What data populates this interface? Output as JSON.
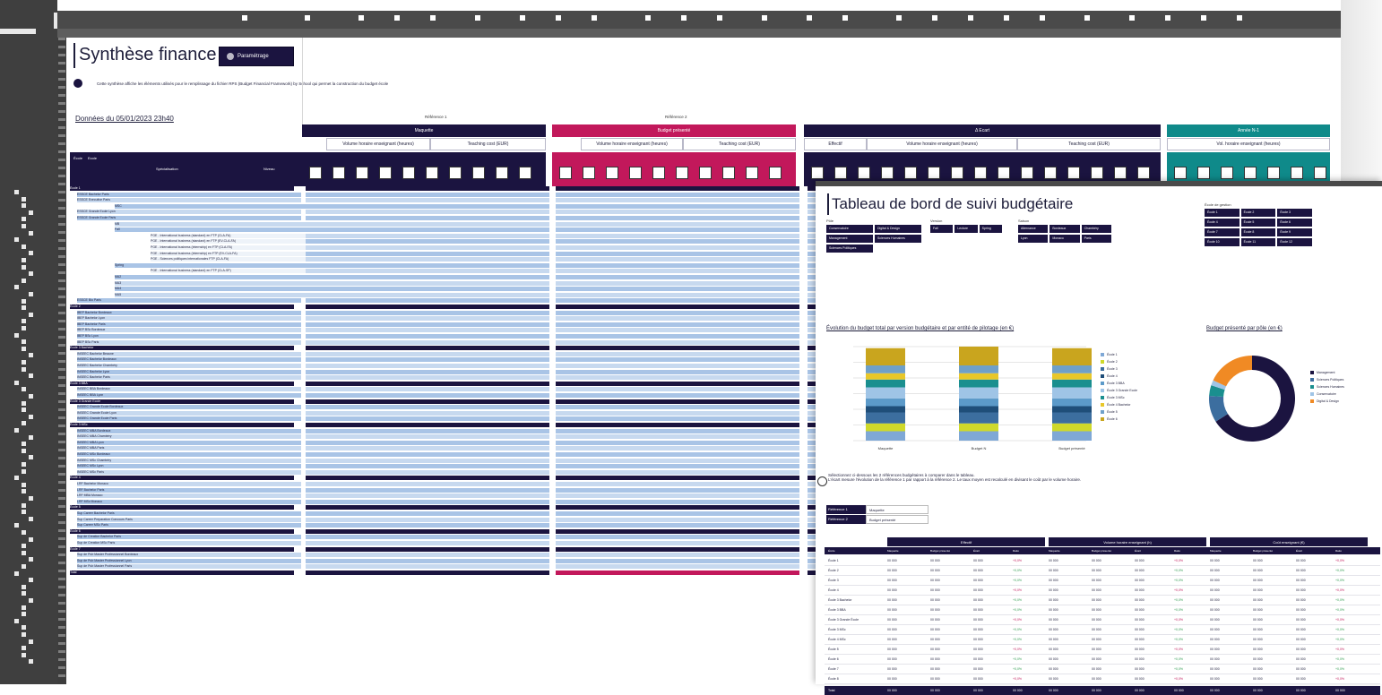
{
  "sheet": {
    "title": "Synthèse finance",
    "param_button": "Paramétrage",
    "info_text": "Cette synthèse affiche les éléments utilisés pour le remplissage du fichier RPS (Budget Financial Framework) by School qui permet la construction du budget école",
    "data_date": "Données du 05/01/2023 23h40",
    "ref1_label": "Référence 1",
    "ref2_label": "Référence 2",
    "groups": [
      "Maquette",
      "Budget présenté",
      "Δ Ecart",
      "Année N-1"
    ],
    "subheaders": [
      "Volume horaire enseignant (heures)",
      "Teaching cost (EUR)",
      "Volume horaire enseignant (heures)",
      "Teaching cost (EUR)",
      "Effectif",
      "Volume horaire enseignant (heures)",
      "Teaching cost (EUR)",
      "Vol. horaire enseignant (heures)"
    ],
    "filter_labels": [
      "École",
      "Ecole",
      "Spécialisation",
      "Niveau"
    ],
    "row_labels": [
      "École 1",
      "ESSCE Bachelor Paris",
      "ESSCE Executive Paris",
      "MSC",
      "ESSCE Grande Ecole Lyon",
      "ESSCE Grande Ecole Paris",
      "MB",
      "Fall",
      "PGE - International business (standard) en FTP (CLA-FA)",
      "PGE - International business (standard) en FTP (EV-CLA-FA)",
      "PGE - International business (internship) en FTP (CLA-FA)",
      "PGE - International business (internship) en FTP (EV-CLA-FA)",
      "PGE - Sciences politiques internationales FTP (CLA-FA)",
      "Spring",
      "PGE - International business (standard) en FTP (CLA-SP)",
      "MA2",
      "MA3",
      "MA4",
      "MA5",
      "ESSCE Bio Paris",
      "École 2",
      "IBEP Bachelor Bordeaux",
      "IBEP Bachelor Lyon",
      "IBEP Bachelor Paris",
      "IBEP BSc Bordeaux",
      "IBEP BSc Lyon",
      "IBEP BSc Paris",
      "École 3 Bachelor",
      "INSEEC Bachelor Beaune",
      "INSEEC Bachelor Bordeaux",
      "INSEEC Bachelor Chambéry",
      "INSEEC Bachelor Lyon",
      "INSEEC Bachelor Paris",
      "École 3 BBA",
      "INSEEC BBA Bordeaux",
      "INSEEC BBA Lyon",
      "École 3 Grande Ecole",
      "INSEEC Grande Ecole Bordeaux",
      "INSEEC Grande Ecole Lyon",
      "INSEEC Grande Ecole Paris",
      "École 3 MSc",
      "INSEEC MBA Bordeaux",
      "INSEEC MBA Chambéry",
      "INSEEC MBA Lyon",
      "INSEEC MBA Paris",
      "INSEEC MSc Bordeaux",
      "INSEEC MSc Chambéry",
      "INSEEC MSc Lyon",
      "INSEEC MSc Paris",
      "École 4",
      "LRF Bachelor Monaco",
      "LRF Bachelor Paris",
      "LRF MBA Monaco",
      "LRF MSc Monaco",
      "École 5",
      "Sup Career Bachelor Paris",
      "Sup Career Preparation Concours Paris",
      "Sup Career MSc Paris",
      "École 6",
      "Sup de Creation Bachelor Paris",
      "Sup de Creation MSc Paris",
      "École 7",
      "Sup de Pub Master Professionnel Bordeaux",
      "Sup de Pub Master Professionnel Lyon",
      "Sup de Pub Master Professionnel Paris",
      "Total"
    ],
    "cell_value": "0.000",
    "delta_pos": "+42,3%",
    "delta_neg": "-100,0%"
  },
  "dashboard": {
    "title": "Tableau de bord de suivi budgétaire",
    "slicers": [
      {
        "header": "Pôle",
        "items": [
          "Conservatoire",
          "Digital & Design",
          "Management",
          "Sciences Humaines",
          "Sciences Politiques"
        ]
      },
      {
        "header": "Version",
        "items": [
          "Fall",
          "Lecture",
          "Spring"
        ]
      },
      {
        "header": "Saison",
        "items": [
          "Alternance",
          "Bordeaux",
          "Chambéry",
          "Lyon",
          "Monaco",
          "Paris"
        ]
      },
      {
        "header": "École de gestion",
        "items": [
          "École 1",
          "École 2",
          "École 3",
          "École 4",
          "École 5",
          "École 6",
          "École 7",
          "École 8",
          "École 9",
          "École 10",
          "École 11",
          "École 12"
        ]
      }
    ],
    "chart1_title": "Évolution du budget total par version budgétaire et par entité de pilotage (en €)",
    "chart2_title": "Budget présenté par pôle (en €)",
    "bar_categories": [
      "Maquette",
      "Budget N",
      "Budget présenté"
    ],
    "bar_legend": [
      "École 1",
      "École 2",
      "École 3",
      "École 4",
      "École 3 BBA",
      "École 3 Grande Ecole",
      "École 3 MSc",
      "École 4 Bachelor",
      "École 5",
      "École 6"
    ],
    "pie_legend": [
      "Management",
      "Sciences Politiques",
      "Sciences Humaines",
      "Conservatoire",
      "Digital & Design"
    ],
    "note_line1": "Sélectionnez ci-dessous les 2 références budgétaires à comparer dans le tableau.",
    "note_line2": "L'écart mesure l'évolution de la référence 1 par rapport à la référence 2. Le taux moyen est recalculé en divisant le coût par le volume horaire.",
    "ref_selectors": [
      {
        "key": "Référence 1",
        "value": "Maquette"
      },
      {
        "key": "Référence 2",
        "value": "Budget présenté"
      }
    ],
    "table_groups": [
      "Effectif",
      "Volume horaire enseignant (h)",
      "Coût enseignant (€)"
    ],
    "table_sub": [
      "Maquette",
      "Budget présenté",
      "Écart",
      "Ratio",
      "Maquette",
      "Budget présenté",
      "Écart",
      "Ratio",
      "Maquette",
      "Budget présenté",
      "Écart",
      "Ratio"
    ],
    "table_col_head": "École",
    "table_rows": [
      "École 1",
      "École 2",
      "École 3",
      "École 4",
      "École 3 Bachelor",
      "École 3 BBA",
      "École 3 Grande École",
      "École 3 MSc",
      "École 4 MSc",
      "École 5",
      "École 6",
      "École 7",
      "École 8"
    ],
    "table_total": "Total",
    "table_value": "00 000",
    "table_delta": "+0,0%"
  },
  "colors": {
    "navy": "#1b1440",
    "crimson": "#c2185b",
    "teal": "#0f8a8a",
    "light_blue": "#a9c4e6",
    "lighter_blue": "#c7d9ef",
    "orange": "#f08a24"
  },
  "chart_data": [
    {
      "type": "bar",
      "title": "Évolution du budget total par version budgétaire et par entité de pilotage (en €)",
      "categories": [
        "Maquette",
        "Budget N",
        "Budget présenté"
      ],
      "stacked": true,
      "series": [
        {
          "name": "École 1",
          "values": [
            6,
            6,
            6
          ]
        },
        {
          "name": "École 2",
          "values": [
            5,
            5,
            5
          ]
        },
        {
          "name": "École 3",
          "values": [
            7,
            7,
            7
          ]
        },
        {
          "name": "École 4",
          "values": [
            4,
            4,
            4
          ]
        },
        {
          "name": "École 3 BBA",
          "values": [
            5,
            5,
            5
          ]
        },
        {
          "name": "École 3 Grande Ecole",
          "values": [
            7,
            7,
            7
          ]
        },
        {
          "name": "École 3 MSc",
          "values": [
            5,
            5,
            5
          ]
        },
        {
          "name": "École 4 Bachelor",
          "values": [
            4,
            4,
            4
          ]
        },
        {
          "name": "École 5",
          "values": [
            5,
            5,
            5
          ]
        },
        {
          "name": "École 6",
          "values": [
            11,
            12,
            11
          ]
        }
      ]
    },
    {
      "type": "pie",
      "title": "Budget présenté par pôle (en €)",
      "donut": true,
      "labels": [
        "Management",
        "Sciences Politiques",
        "Sciences Humaines",
        "Conservatoire",
        "Digital & Design"
      ],
      "values": [
        66,
        10,
        4,
        2,
        18
      ]
    }
  ]
}
